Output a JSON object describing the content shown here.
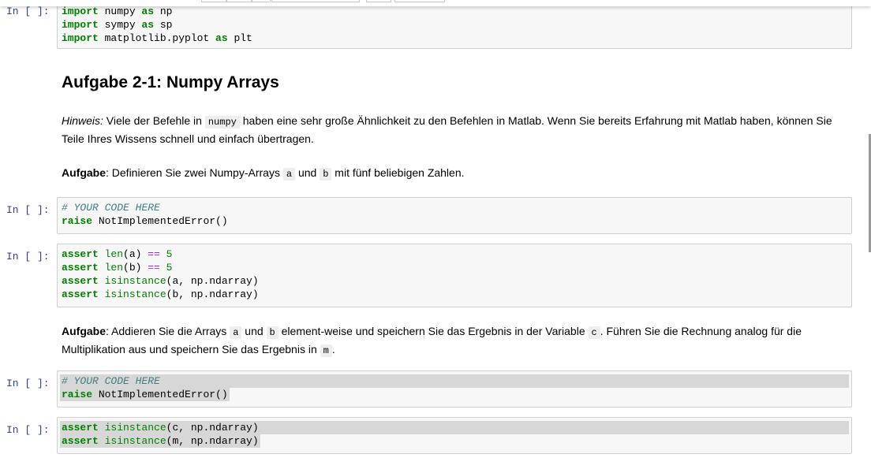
{
  "cells": {
    "c1": {
      "prompt": "In [ ]:",
      "lines": [
        [
          [
            "kw",
            "import"
          ],
          [
            "t",
            " numpy "
          ],
          [
            "kw",
            "as"
          ],
          [
            "t",
            " np"
          ]
        ],
        [
          [
            "kw",
            "import"
          ],
          [
            "t",
            " sympy "
          ],
          [
            "kw",
            "as"
          ],
          [
            "t",
            " sp"
          ]
        ],
        [
          [
            "kw",
            "import"
          ],
          [
            "t",
            " matplotlib.pyplot "
          ],
          [
            "kw",
            "as"
          ],
          [
            "t",
            " plt"
          ]
        ]
      ]
    },
    "md1": {
      "heading": "Aufgabe 2-1: Numpy Arrays"
    },
    "md2": {
      "hint_label": "Hinweis:",
      "hint_text_1": " Viele der Befehle in ",
      "hint_code": "numpy",
      "hint_text_2": " haben eine sehr große Ähnlichkeit zu den Befehlen in Matlab. Wenn Sie bereits Erfahrung mit Matlab haben, können Sie Teile Ihres Wissens schnell und einfach übertragen."
    },
    "md3": {
      "task_label": "Aufgabe",
      "t1": ": Definieren Sie zwei Numpy-Arrays ",
      "a": "a",
      "t2": " und ",
      "b": "b",
      "t3": " mit fünf beliebigen Zahlen."
    },
    "c2": {
      "prompt": "In [ ]:",
      "lines": [
        [
          [
            "cm",
            "# YOUR CODE HERE"
          ]
        ],
        [
          [
            "kw",
            "raise"
          ],
          [
            "t",
            " NotImplementedError()"
          ]
        ]
      ]
    },
    "c3": {
      "prompt": "In [ ]:",
      "lines": [
        [
          [
            "kw",
            "assert"
          ],
          [
            "t",
            " "
          ],
          [
            "bi",
            "len"
          ],
          [
            "t",
            "(a) "
          ],
          [
            "op",
            "=="
          ],
          [
            "t",
            " "
          ],
          [
            "num",
            "5"
          ]
        ],
        [
          [
            "kw",
            "assert"
          ],
          [
            "t",
            " "
          ],
          [
            "bi",
            "len"
          ],
          [
            "t",
            "(b) "
          ],
          [
            "op",
            "=="
          ],
          [
            "t",
            " "
          ],
          [
            "num",
            "5"
          ]
        ],
        [
          [
            "kw",
            "assert"
          ],
          [
            "t",
            " "
          ],
          [
            "bi",
            "isinstance"
          ],
          [
            "t",
            "(a, np.ndarray)"
          ]
        ],
        [
          [
            "kw",
            "assert"
          ],
          [
            "t",
            " "
          ],
          [
            "bi",
            "isinstance"
          ],
          [
            "t",
            "(b, np.ndarray)"
          ]
        ]
      ]
    },
    "md4": {
      "task_label": "Aufgabe",
      "t1": ": Addieren Sie die Arrays ",
      "a": "a",
      "t2": " und ",
      "b": "b",
      "t3": " element-weise und speichern Sie das Ergebnis in der Variable ",
      "c": "c",
      "t4": ". Führen Sie die Rechnung analog für die Multiplikation aus und speichern Sie das Ergebnis in ",
      "m": "m",
      "t5": "."
    },
    "c4": {
      "prompt": "In [ ]:",
      "lines": [
        [
          [
            "cm",
            "# YOUR CODE HERE"
          ]
        ],
        [
          [
            "kw",
            "raise"
          ],
          [
            "t",
            " NotImplementedError()"
          ]
        ]
      ]
    },
    "c5": {
      "prompt": "In [ ]:",
      "lines": [
        [
          [
            "kw",
            "assert"
          ],
          [
            "t",
            " "
          ],
          [
            "bi",
            "isinstance"
          ],
          [
            "t",
            "(c, np.ndarray)"
          ]
        ],
        [
          [
            "kw",
            "assert"
          ],
          [
            "t",
            " "
          ],
          [
            "bi",
            "isinstance"
          ],
          [
            "t",
            "(m, np.ndarray)"
          ]
        ]
      ]
    }
  }
}
